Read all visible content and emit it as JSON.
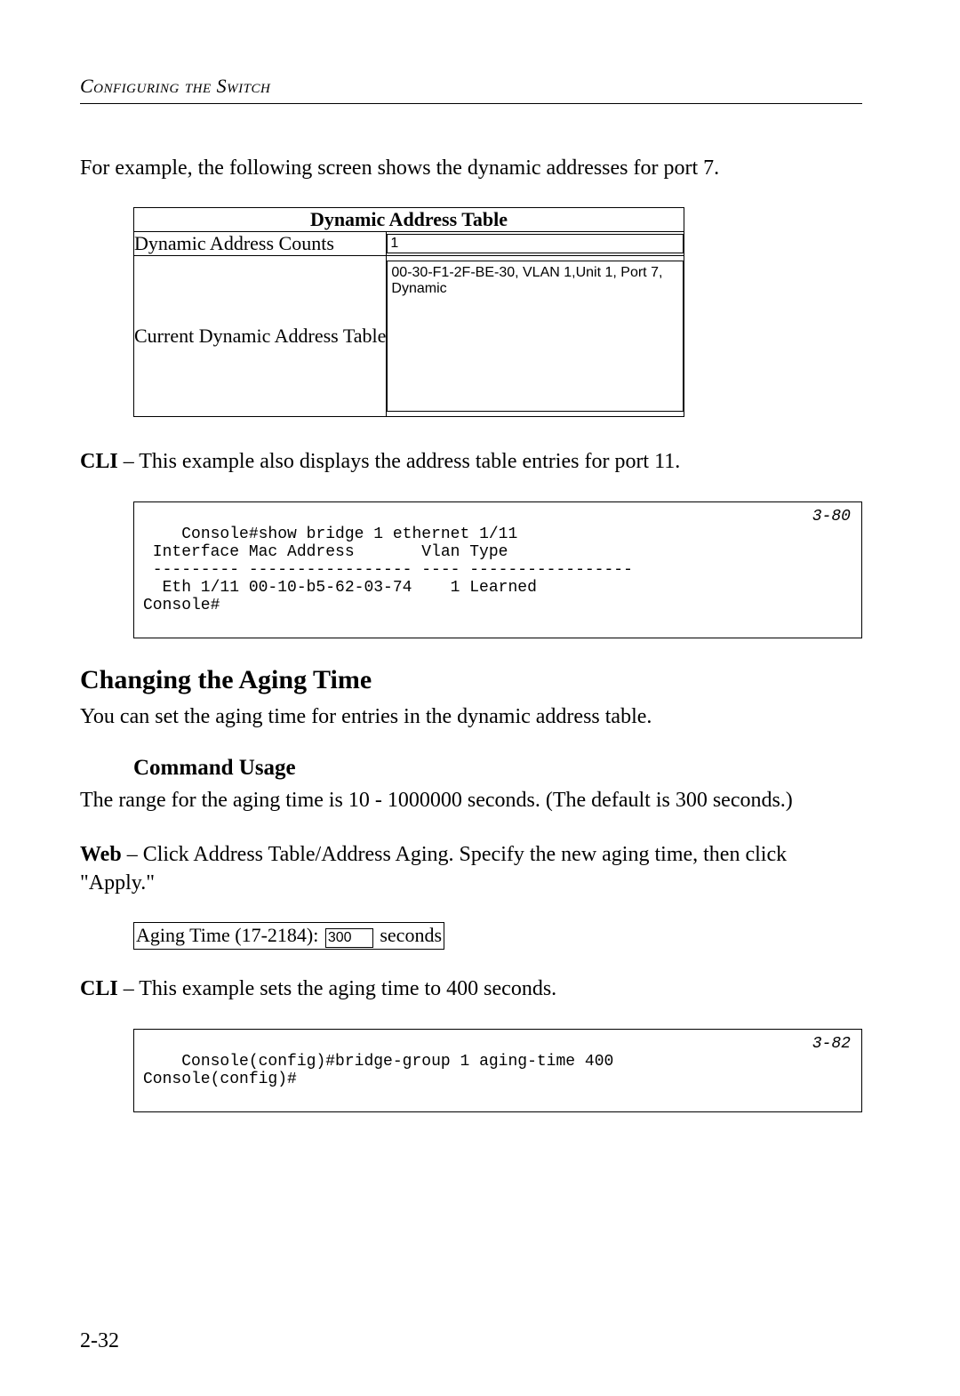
{
  "running_head": "Configuring the Switch",
  "intro_para": "For example, the following screen shows the dynamic addresses for port 7.",
  "dat": {
    "title": "Dynamic Address Table",
    "row1_label": "Dynamic Address Counts",
    "row1_value": "1",
    "row2_label": "Current Dynamic Address Table",
    "row2_value": "00-30-F1-2F-BE-30, VLAN 1,Unit 1, Port 7, Dynamic"
  },
  "cli1_lead": "CLI",
  "cli1_text": " – This example also displays the address table entries for port 11.",
  "cli1_code": "Console#show bridge 1 ethernet 1/11\n Interface Mac Address       Vlan Type\n --------- ----------------- ---- -----------------\n  Eth 1/11 00-10-b5-62-03-74    1 Learned\nConsole#",
  "cli1_ref": "3-80",
  "section_title": "Changing the Aging Time",
  "section_intro": "You can set the aging time for entries in the dynamic address table.",
  "subheading": "Command Usage",
  "usage_text": "The range for the aging time is 10 - 1000000 seconds. (The default is 300 seconds.)",
  "web_lead": "Web",
  "web_text": " – Click Address Table/Address Aging. Specify the new aging time, then click \"Apply.\"",
  "aging": {
    "label": "Aging Time (17-2184):",
    "value": "300",
    "unit": "seconds"
  },
  "cli2_lead": "CLI",
  "cli2_text": " – This example sets the aging time to 400 seconds.",
  "cli2_code": "Console(config)#bridge-group 1 aging-time 400\nConsole(config)#",
  "cli2_ref": "3-82",
  "page_number": "2-32"
}
